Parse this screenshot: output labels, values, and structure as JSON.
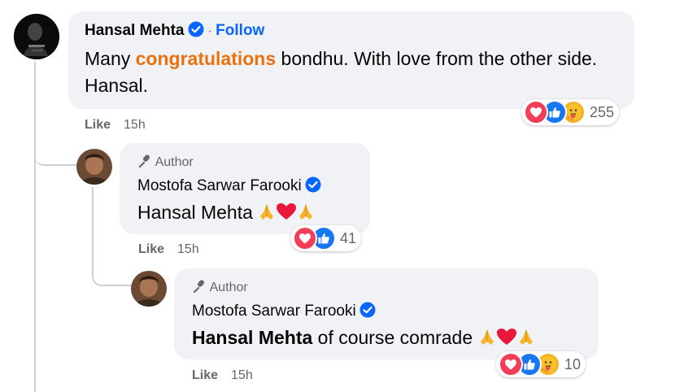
{
  "colors": {
    "accent": "#0866ff",
    "highlight": "#e9710f",
    "secondary_text": "#65676b",
    "bubble": "#f0f2f5"
  },
  "comment": {
    "author": "Hansal Mehta",
    "follow_label": "Follow",
    "separator": "·",
    "text_before": "Many ",
    "text_highlight": "congratulations",
    "text_after": " bondhu. With love from the other side. Hansal.",
    "like_label": "Like",
    "time": "15h",
    "reaction_icons": [
      "love-icon",
      "like-icon",
      "care-icon"
    ],
    "reaction_count": "255"
  },
  "replies": [
    {
      "badge": "Author",
      "author": "Mostofa Sarwar Farooki",
      "mention": "Hansal Mehta",
      "text": "",
      "emojis": [
        "folded-hands-icon",
        "red-heart-icon",
        "folded-hands-icon"
      ],
      "like_label": "Like",
      "time": "15h",
      "reaction_icons": [
        "love-icon",
        "like-icon"
      ],
      "reaction_count": "41"
    },
    {
      "badge": "Author",
      "author": "Mostofa Sarwar Farooki",
      "mention": "Hansal Mehta",
      "text": " of course comrade ",
      "emojis": [
        "folded-hands-icon",
        "red-heart-icon",
        "folded-hands-icon"
      ],
      "like_label": "Like",
      "time": "15h",
      "reaction_icons": [
        "love-icon",
        "like-icon",
        "care-icon"
      ],
      "reaction_count": "10"
    }
  ]
}
